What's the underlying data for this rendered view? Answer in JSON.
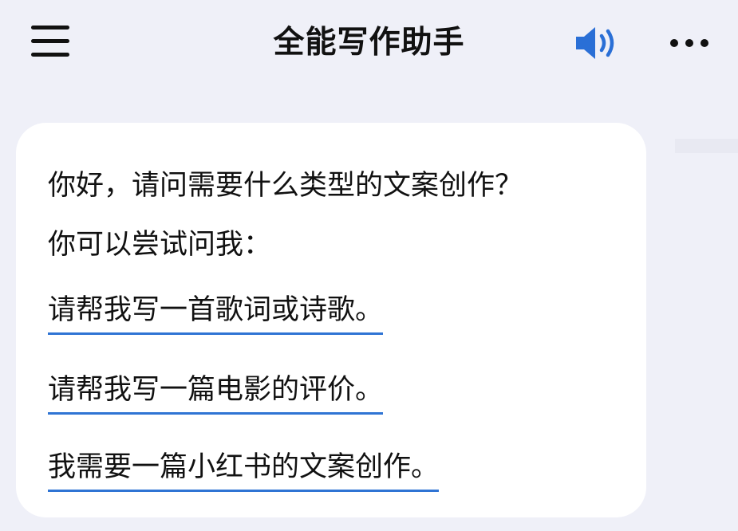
{
  "header": {
    "title": "全能写作助手",
    "icons": {
      "menu": "hamburger-menu-icon",
      "speaker": "speaker-sound-icon",
      "more": "more-dots-icon"
    },
    "colors": {
      "speaker": "#2a6fd6",
      "text": "#111111"
    }
  },
  "chat": {
    "message": {
      "greeting_line1": "你好，请问需要什么类型的文案创作？",
      "greeting_line2": "你可以尝试问我："
    },
    "suggestions": [
      {
        "label": "请帮我写一首歌词或诗歌。"
      },
      {
        "label": "请帮我写一篇电影的评价。"
      },
      {
        "label": "我需要一篇小红书的文案创作。"
      }
    ],
    "colors": {
      "background": "#eff0f8",
      "bubble": "#ffffff",
      "link_underline": "#2f74d4"
    }
  }
}
